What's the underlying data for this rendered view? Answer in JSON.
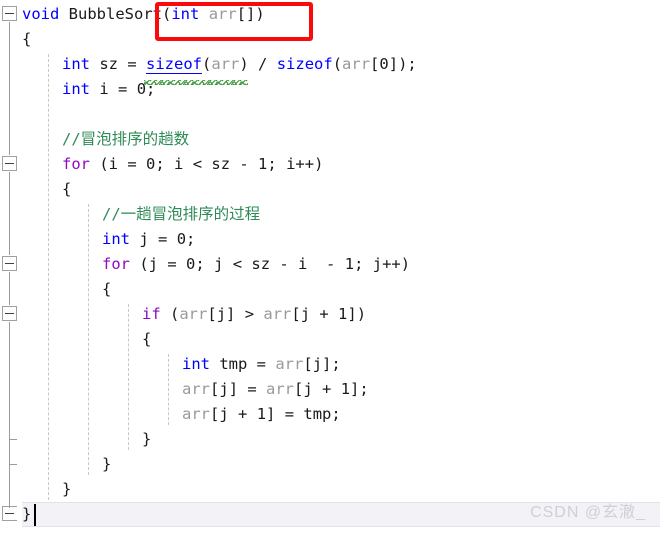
{
  "app": {
    "kind": "code-editor",
    "language": "C",
    "theme": "light",
    "colors": {
      "background": "#ffffff",
      "keyword": "#0000ff",
      "control_keyword": "#8f08c4",
      "comment": "#2e8b57",
      "identifier_dim": "#9a9a9a",
      "plain_text": "#1a1a1a",
      "annotation_red": "#fa0a0a",
      "current_line": "#f2f2f7",
      "indent_guide": "#c8c8c8",
      "gutter_line": "#9b9b9b",
      "watermark": "#cfcfd6"
    }
  },
  "editor": {
    "lines": [
      {
        "n": 1,
        "indent": 0,
        "tokens": [
          {
            "t": "void",
            "c": "kw"
          },
          {
            "t": " ",
            "c": "punct"
          },
          {
            "t": "BubbleSort",
            "c": "ident"
          },
          {
            "t": "(",
            "c": "punct"
          },
          {
            "t": "int",
            "c": "kw"
          },
          {
            "t": " ",
            "c": "punct"
          },
          {
            "t": "arr",
            "c": "dim"
          },
          {
            "t": "[])",
            "c": "punct"
          }
        ]
      },
      {
        "n": 2,
        "indent": 0,
        "tokens": [
          {
            "t": "{",
            "c": "brace"
          }
        ]
      },
      {
        "n": 3,
        "indent": 1,
        "tokens": [
          {
            "t": "int",
            "c": "kw"
          },
          {
            "t": " ",
            "c": "punct"
          },
          {
            "t": "sz",
            "c": "ident"
          },
          {
            "t": " = ",
            "c": "op"
          },
          {
            "t": "sizeof",
            "c": "link"
          },
          {
            "t": "(",
            "c": "punct"
          },
          {
            "t": "arr",
            "c": "dim"
          },
          {
            "t": ")",
            "c": "punct"
          },
          {
            "t": " / ",
            "c": "op"
          },
          {
            "t": "sizeof",
            "c": "kw"
          },
          {
            "t": "(",
            "c": "punct"
          },
          {
            "t": "arr",
            "c": "dim"
          },
          {
            "t": "[",
            "c": "punct"
          },
          {
            "t": "0",
            "c": "num"
          },
          {
            "t": "]);",
            "c": "punct"
          }
        ]
      },
      {
        "n": 4,
        "indent": 1,
        "tokens": [
          {
            "t": "int",
            "c": "kw"
          },
          {
            "t": " ",
            "c": "punct"
          },
          {
            "t": "i",
            "c": "ident"
          },
          {
            "t": " = ",
            "c": "op"
          },
          {
            "t": "0",
            "c": "num"
          },
          {
            "t": ";",
            "c": "punct"
          }
        ]
      },
      {
        "n": 5,
        "indent": 1,
        "tokens": []
      },
      {
        "n": 6,
        "indent": 1,
        "tokens": [
          {
            "t": "//冒泡排序的趟数",
            "c": "cmt"
          }
        ]
      },
      {
        "n": 7,
        "indent": 1,
        "tokens": [
          {
            "t": "for",
            "c": "ctrl"
          },
          {
            "t": " (",
            "c": "punct"
          },
          {
            "t": "i",
            "c": "ident"
          },
          {
            "t": " = ",
            "c": "op"
          },
          {
            "t": "0",
            "c": "num"
          },
          {
            "t": "; ",
            "c": "punct"
          },
          {
            "t": "i",
            "c": "ident"
          },
          {
            "t": " < ",
            "c": "op"
          },
          {
            "t": "sz",
            "c": "ident"
          },
          {
            "t": " - ",
            "c": "op"
          },
          {
            "t": "1",
            "c": "num"
          },
          {
            "t": "; ",
            "c": "punct"
          },
          {
            "t": "i",
            "c": "ident"
          },
          {
            "t": "++)",
            "c": "punct"
          }
        ]
      },
      {
        "n": 8,
        "indent": 1,
        "tokens": [
          {
            "t": "{",
            "c": "brace"
          }
        ]
      },
      {
        "n": 9,
        "indent": 2,
        "tokens": [
          {
            "t": "//一趟冒泡排序的过程",
            "c": "cmt"
          }
        ]
      },
      {
        "n": 10,
        "indent": 2,
        "tokens": [
          {
            "t": "int",
            "c": "kw"
          },
          {
            "t": " ",
            "c": "punct"
          },
          {
            "t": "j",
            "c": "ident"
          },
          {
            "t": " = ",
            "c": "op"
          },
          {
            "t": "0",
            "c": "num"
          },
          {
            "t": ";",
            "c": "punct"
          }
        ]
      },
      {
        "n": 11,
        "indent": 2,
        "tokens": [
          {
            "t": "for",
            "c": "ctrl"
          },
          {
            "t": " (",
            "c": "punct"
          },
          {
            "t": "j",
            "c": "ident"
          },
          {
            "t": " = ",
            "c": "op"
          },
          {
            "t": "0",
            "c": "num"
          },
          {
            "t": "; ",
            "c": "punct"
          },
          {
            "t": "j",
            "c": "ident"
          },
          {
            "t": " < ",
            "c": "op"
          },
          {
            "t": "sz",
            "c": "ident"
          },
          {
            "t": " - ",
            "c": "op"
          },
          {
            "t": "i",
            "c": "ident"
          },
          {
            "t": "  - ",
            "c": "op"
          },
          {
            "t": "1",
            "c": "num"
          },
          {
            "t": "; ",
            "c": "punct"
          },
          {
            "t": "j",
            "c": "ident"
          },
          {
            "t": "++)",
            "c": "punct"
          }
        ]
      },
      {
        "n": 12,
        "indent": 2,
        "tokens": [
          {
            "t": "{",
            "c": "brace"
          }
        ]
      },
      {
        "n": 13,
        "indent": 3,
        "tokens": [
          {
            "t": "if",
            "c": "ctrl"
          },
          {
            "t": " (",
            "c": "punct"
          },
          {
            "t": "arr",
            "c": "dim"
          },
          {
            "t": "[",
            "c": "punct"
          },
          {
            "t": "j",
            "c": "ident"
          },
          {
            "t": "] > ",
            "c": "op"
          },
          {
            "t": "arr",
            "c": "dim"
          },
          {
            "t": "[",
            "c": "punct"
          },
          {
            "t": "j",
            "c": "ident"
          },
          {
            "t": " + ",
            "c": "op"
          },
          {
            "t": "1",
            "c": "num"
          },
          {
            "t": "])",
            "c": "punct"
          }
        ]
      },
      {
        "n": 14,
        "indent": 3,
        "tokens": [
          {
            "t": "{",
            "c": "brace"
          }
        ]
      },
      {
        "n": 15,
        "indent": 4,
        "tokens": [
          {
            "t": "int",
            "c": "kw"
          },
          {
            "t": " ",
            "c": "punct"
          },
          {
            "t": "tmp",
            "c": "ident"
          },
          {
            "t": " = ",
            "c": "op"
          },
          {
            "t": "arr",
            "c": "dim"
          },
          {
            "t": "[",
            "c": "punct"
          },
          {
            "t": "j",
            "c": "ident"
          },
          {
            "t": "];",
            "c": "punct"
          }
        ]
      },
      {
        "n": 16,
        "indent": 4,
        "tokens": [
          {
            "t": "arr",
            "c": "dim"
          },
          {
            "t": "[",
            "c": "punct"
          },
          {
            "t": "j",
            "c": "ident"
          },
          {
            "t": "] = ",
            "c": "op"
          },
          {
            "t": "arr",
            "c": "dim"
          },
          {
            "t": "[",
            "c": "punct"
          },
          {
            "t": "j",
            "c": "ident"
          },
          {
            "t": " + ",
            "c": "op"
          },
          {
            "t": "1",
            "c": "num"
          },
          {
            "t": "];",
            "c": "punct"
          }
        ]
      },
      {
        "n": 17,
        "indent": 4,
        "tokens": [
          {
            "t": "arr",
            "c": "dim"
          },
          {
            "t": "[",
            "c": "punct"
          },
          {
            "t": "j",
            "c": "ident"
          },
          {
            "t": " + ",
            "c": "op"
          },
          {
            "t": "1",
            "c": "num"
          },
          {
            "t": "] = ",
            "c": "op"
          },
          {
            "t": "tmp",
            "c": "ident"
          },
          {
            "t": ";",
            "c": "punct"
          }
        ]
      },
      {
        "n": 18,
        "indent": 3,
        "tokens": [
          {
            "t": "}",
            "c": "brace"
          }
        ]
      },
      {
        "n": 19,
        "indent": 2,
        "tokens": [
          {
            "t": "}",
            "c": "brace"
          }
        ]
      },
      {
        "n": 20,
        "indent": 1,
        "tokens": [
          {
            "t": "}",
            "c": "brace"
          }
        ]
      },
      {
        "n": 21,
        "indent": 0,
        "tokens": [
          {
            "t": "}",
            "c": "brace"
          }
        ]
      }
    ],
    "current_line": 21,
    "caret_visible": true
  },
  "gutter": {
    "collapse_markers": [
      {
        "line": 1,
        "state": "expanded",
        "glyph": "minus"
      },
      {
        "line": 7,
        "state": "expanded",
        "glyph": "minus"
      },
      {
        "line": 11,
        "state": "expanded",
        "glyph": "minus"
      },
      {
        "line": 13,
        "state": "expanded",
        "glyph": "minus"
      }
    ],
    "brace_ticks": [
      18,
      19
    ]
  },
  "annotation": {
    "type": "rectangle",
    "color": "#fa0a0a",
    "encloses": "(int arr[])"
  },
  "watermark": {
    "text": "CSDN @玄澈_"
  }
}
